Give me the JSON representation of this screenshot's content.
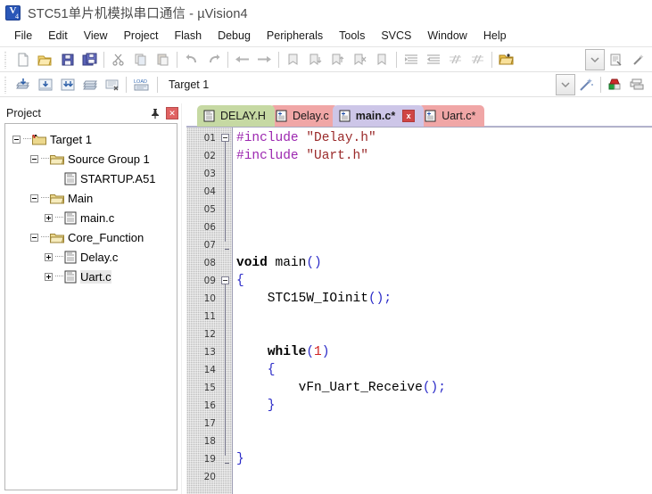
{
  "window": {
    "title": "STC51单片机模拟串口通信  - µVision4",
    "app_icon": "keil-uvision-icon"
  },
  "menubar": {
    "items": [
      {
        "label": "File"
      },
      {
        "label": "Edit"
      },
      {
        "label": "View"
      },
      {
        "label": "Project"
      },
      {
        "label": "Flash"
      },
      {
        "label": "Debug"
      },
      {
        "label": "Peripherals"
      },
      {
        "label": "Tools"
      },
      {
        "label": "SVCS"
      },
      {
        "label": "Window"
      },
      {
        "label": "Help"
      }
    ]
  },
  "toolbar_main": {
    "buttons": [
      {
        "name": "new-file-icon"
      },
      {
        "name": "open-file-icon"
      },
      {
        "name": "save-icon"
      },
      {
        "name": "save-all-icon"
      },
      {
        "name": "cut-icon"
      },
      {
        "name": "copy-icon"
      },
      {
        "name": "paste-icon"
      },
      {
        "name": "undo-icon"
      },
      {
        "name": "redo-icon"
      },
      {
        "name": "navigate-back-icon"
      },
      {
        "name": "navigate-forward-icon"
      },
      {
        "name": "bookmark-toggle-icon"
      },
      {
        "name": "bookmark-next-icon"
      },
      {
        "name": "bookmark-prev-icon"
      },
      {
        "name": "bookmark-clear-icon"
      },
      {
        "name": "indent-increase-icon"
      },
      {
        "name": "indent-decrease-icon"
      },
      {
        "name": "comment-lines-icon"
      },
      {
        "name": "uncomment-lines-icon"
      },
      {
        "name": "open-folder-yellow-icon"
      },
      {
        "name": "dropdown-chevron-icon"
      },
      {
        "name": "configure-target-icon"
      },
      {
        "name": "magic-wand-icon"
      }
    ]
  },
  "toolbar_build": {
    "target_value": "Target 1",
    "buttons": [
      {
        "name": "translate-file-icon"
      },
      {
        "name": "build-target-icon"
      },
      {
        "name": "rebuild-all-icon"
      },
      {
        "name": "batch-build-icon"
      },
      {
        "name": "stop-build-icon"
      },
      {
        "name": "download-to-flash-icon"
      },
      {
        "name": "target-options-icon"
      },
      {
        "name": "manage-components-icon"
      }
    ]
  },
  "project_panel": {
    "title": "Project",
    "pin_icon": "pin-icon",
    "close_icon": "close-icon",
    "tree": [
      {
        "label": "Target 1",
        "level": 0,
        "type": "target",
        "toggle": "minus"
      },
      {
        "label": "Source Group 1",
        "level": 1,
        "type": "folder",
        "toggle": "minus"
      },
      {
        "label": "STARTUP.A51",
        "level": 2,
        "type": "file",
        "toggle": "none"
      },
      {
        "label": "Main",
        "level": 1,
        "type": "folder",
        "toggle": "minus"
      },
      {
        "label": "main.c",
        "level": 2,
        "type": "file",
        "toggle": "plus"
      },
      {
        "label": "Core_Function",
        "level": 1,
        "type": "folder",
        "toggle": "minus"
      },
      {
        "label": "Delay.c",
        "level": 2,
        "type": "file",
        "toggle": "plus"
      },
      {
        "label": "Uart.c",
        "level": 2,
        "type": "file",
        "toggle": "plus",
        "selected": true
      }
    ]
  },
  "editor": {
    "tabs": [
      {
        "label": "DELAY.H",
        "color": "green",
        "active": false,
        "closable": false,
        "icon": "header-file-icon"
      },
      {
        "label": "Delay.c",
        "color": "red",
        "active": false,
        "closable": false,
        "icon": "c-file-icon"
      },
      {
        "label": "main.c*",
        "color": "active",
        "active": true,
        "closable": true,
        "close_label": "x",
        "icon": "c-file-icon"
      },
      {
        "label": "Uart.c*",
        "color": "red2",
        "active": false,
        "closable": false,
        "icon": "c-file-icon"
      }
    ],
    "line_numbers": [
      "01",
      "02",
      "03",
      "04",
      "05",
      "06",
      "07",
      "08",
      "09",
      "10",
      "11",
      "12",
      "13",
      "14",
      "15",
      "16",
      "17",
      "18",
      "19",
      "20"
    ],
    "lines": [
      {
        "n": "01",
        "tokens": [
          {
            "t": "#include ",
            "c": "pp"
          },
          {
            "t": "\"Delay.h\"",
            "c": "str"
          }
        ]
      },
      {
        "n": "02",
        "tokens": [
          {
            "t": "#include ",
            "c": "pp"
          },
          {
            "t": "\"Uart.h\"",
            "c": "str"
          }
        ]
      },
      {
        "n": "03",
        "tokens": []
      },
      {
        "n": "04",
        "tokens": []
      },
      {
        "n": "05",
        "tokens": []
      },
      {
        "n": "06",
        "tokens": []
      },
      {
        "n": "07",
        "tokens": []
      },
      {
        "n": "08",
        "tokens": [
          {
            "t": "void",
            "c": "kw"
          },
          {
            "t": " main",
            "c": "id"
          },
          {
            "t": "()",
            "c": "punc"
          }
        ]
      },
      {
        "n": "09",
        "tokens": [
          {
            "t": "{",
            "c": "punc"
          }
        ]
      },
      {
        "n": "10",
        "tokens": [
          {
            "t": "    STC15W_IOinit",
            "c": "id"
          },
          {
            "t": "();",
            "c": "punc"
          }
        ]
      },
      {
        "n": "11",
        "tokens": []
      },
      {
        "n": "12",
        "tokens": []
      },
      {
        "n": "13",
        "tokens": [
          {
            "t": "    ",
            "c": "id"
          },
          {
            "t": "while",
            "c": "kw"
          },
          {
            "t": "(",
            "c": "punc"
          },
          {
            "t": "1",
            "c": "num"
          },
          {
            "t": ")",
            "c": "punc"
          }
        ]
      },
      {
        "n": "14",
        "tokens": [
          {
            "t": "    {",
            "c": "punc"
          }
        ]
      },
      {
        "n": "15",
        "tokens": [
          {
            "t": "        vFn_Uart_Receive",
            "c": "id"
          },
          {
            "t": "();",
            "c": "punc"
          }
        ]
      },
      {
        "n": "16",
        "tokens": [
          {
            "t": "    }",
            "c": "punc"
          }
        ]
      },
      {
        "n": "17",
        "tokens": []
      },
      {
        "n": "18",
        "tokens": []
      },
      {
        "n": "19",
        "tokens": [
          {
            "t": "}",
            "c": "punc"
          }
        ]
      },
      {
        "n": "20",
        "tokens": []
      }
    ]
  },
  "colors": {
    "tab_active": "#cdc6e8",
    "tab_header_green": "#c6d9a3",
    "tab_c_red": "#f0a6a6",
    "close_red": "#d04545",
    "gutter_grey": "#bdbdbd",
    "preprocessor": "#9c27b0",
    "string": "#9a2a2a",
    "number": "#d02020",
    "punctuation": "#2b2bc8"
  }
}
